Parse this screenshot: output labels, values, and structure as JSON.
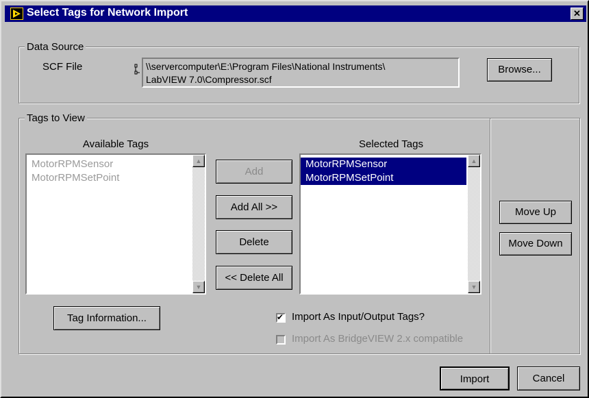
{
  "window": {
    "title": "Select Tags for Network Import",
    "close_glyph": "✕"
  },
  "data_source": {
    "legend": "Data Source",
    "scf_label": "SCF File",
    "path_line1": "\\\\servercomputer\\E:\\Program Files\\National Instruments\\",
    "path_line2": "LabVIEW 7.0\\Compressor.scf",
    "browse_label": "Browse..."
  },
  "tags_to_view": {
    "legend": "Tags to View",
    "available": {
      "header": "Available Tags",
      "items": [
        "MotorRPMSensor",
        "MotorRPMSetPoint"
      ]
    },
    "selected": {
      "header": "Selected Tags",
      "items": [
        "MotorRPMSensor",
        "MotorRPMSetPoint"
      ]
    },
    "buttons": {
      "add": "Add",
      "add_all": "Add All >>",
      "delete": "Delete",
      "delete_all": "<< Delete All"
    },
    "tag_info_label": "Tag Information...",
    "import_io_label": "Import As Input/Output Tags?",
    "import_io_checked": true,
    "import_bv_label": "Import As BridgeVIEW 2.x compatible",
    "import_bv_checked": false,
    "move_up": "Move Up",
    "move_down": "Move Down"
  },
  "footer": {
    "import": "Import",
    "cancel": "Cancel"
  },
  "icons": {
    "title": "labview-arrow-icon",
    "check_glyph": "✔",
    "up": "▲",
    "down": "▼"
  }
}
